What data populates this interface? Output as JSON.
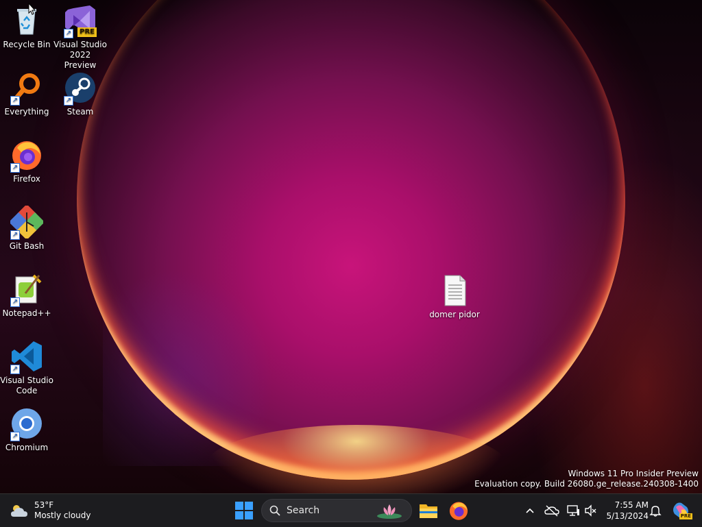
{
  "desktop": {
    "icons": [
      {
        "label_lines": [
          "Recycle Bin"
        ],
        "icon": "recycle-bin-icon"
      },
      {
        "label_lines": [
          "Visual Studio",
          "2022 Preview"
        ],
        "icon": "visual-studio-preview-icon",
        "badge": "PRE"
      },
      {
        "label_lines": [
          "Everything"
        ],
        "icon": "everything-search-icon"
      },
      {
        "label_lines": [
          "Steam"
        ],
        "icon": "steam-icon"
      },
      {
        "label_lines": [
          "Firefox"
        ],
        "icon": "firefox-icon"
      },
      {
        "label_lines": [
          "Git Bash"
        ],
        "icon": "git-bash-icon"
      },
      {
        "label_lines": [
          "Notepad++"
        ],
        "icon": "notepad-plus-plus-icon"
      },
      {
        "label_lines": [
          "Visual Studio",
          "Code"
        ],
        "icon": "vscode-icon"
      },
      {
        "label_lines": [
          "Chromium"
        ],
        "icon": "chromium-icon"
      },
      {
        "label_lines": [
          "domer pidor"
        ],
        "icon": "text-file-icon"
      }
    ],
    "watermark": {
      "line1": "Windows 11 Pro Insider Preview",
      "line2": "Evaluation copy. Build 26080.ge_release.240308-1400"
    }
  },
  "taskbar": {
    "weather": {
      "temp": "53°F",
      "condition": "Mostly cloudy"
    },
    "search_placeholder": "Search",
    "clock": {
      "time": "7:55 AM",
      "date": "5/13/2024"
    },
    "pinned": [
      "file-explorer-icon",
      "firefox-icon"
    ],
    "tray": [
      "chevron-up-icon",
      "onedrive-off-icon",
      "network-icon",
      "volume-muted-icon",
      "notification-bell-icon",
      "copilot-icon"
    ],
    "copilot_badge": "PRE"
  },
  "colors": {
    "taskbar": "#1c1c1f",
    "accent_blue": "#2b8ae6"
  }
}
